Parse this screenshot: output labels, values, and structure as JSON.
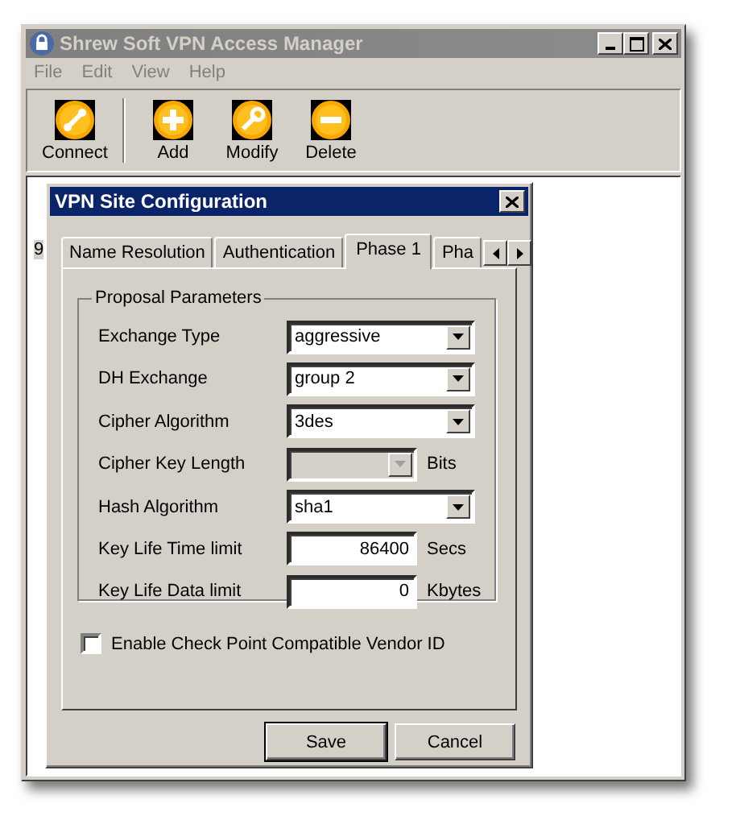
{
  "window": {
    "title": "Shrew Soft VPN Access Manager"
  },
  "menu": [
    {
      "label": "File"
    },
    {
      "label": "Edit"
    },
    {
      "label": "View"
    },
    {
      "label": "Help"
    }
  ],
  "toolbar": [
    {
      "label": "Connect",
      "kind": "connect"
    },
    {
      "label": "Add",
      "kind": "add"
    },
    {
      "label": "Modify",
      "kind": "modify"
    },
    {
      "label": "Delete",
      "kind": "delete"
    }
  ],
  "site_list": {
    "visible_text": "9"
  },
  "dialog": {
    "title": "VPN Site Configuration",
    "tabs": [
      {
        "label": "Name Resolution",
        "selected": false
      },
      {
        "label": "Authentication",
        "selected": false
      },
      {
        "label": "Phase 1",
        "selected": true
      },
      {
        "label": "Pha",
        "selected": false
      }
    ],
    "group": {
      "title": "Proposal Parameters",
      "fields": [
        {
          "label": "Exchange Type",
          "kind": "select",
          "value": "aggressive",
          "disabled": false
        },
        {
          "label": "DH Exchange",
          "kind": "select",
          "value": "group 2",
          "disabled": false
        },
        {
          "label": "Cipher Algorithm",
          "kind": "select",
          "value": "3des",
          "disabled": false
        },
        {
          "label": "Cipher Key Length",
          "kind": "select",
          "disabled": true,
          "unit": "Bits"
        },
        {
          "label": "Hash Algorithm",
          "kind": "select",
          "value": "sha1",
          "disabled": false
        },
        {
          "label": "Key Life Time limit",
          "kind": "number",
          "value": "86400",
          "disabled": false,
          "unit": "Secs"
        },
        {
          "label": "Key Life Data limit",
          "kind": "number",
          "value": "0",
          "disabled": false,
          "unit": "Kbytes"
        }
      ]
    },
    "checkbox": {
      "label": "Enable Check Point Compatible Vendor ID",
      "checked": false
    },
    "buttons": [
      {
        "label": "Save",
        "default": true
      },
      {
        "label": "Cancel",
        "default": false
      }
    ]
  }
}
